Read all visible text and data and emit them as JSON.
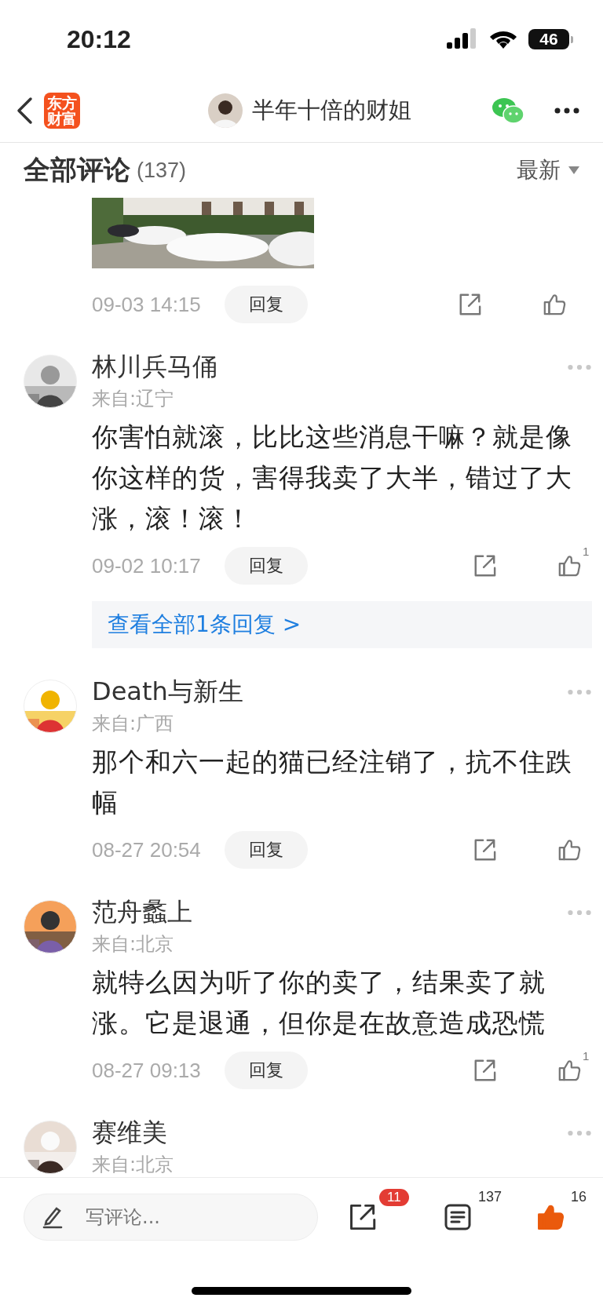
{
  "status_bar": {
    "time": "20:12",
    "battery": "46"
  },
  "nav": {
    "logo": "东方财富",
    "title": "半年十倍的财姐"
  },
  "comments_header": {
    "title": "全部评论",
    "count": "(137)",
    "sort": "最新"
  },
  "comments": [
    {
      "time": "09-03 14:15",
      "reply": "回复"
    },
    {
      "name": "林川兵马俑",
      "location": "来自:辽宁",
      "body": "你害怕就滚，比比这些消息干嘛？就是像你这样的货，害得我卖了大半，错过了大涨，滚！滚！",
      "time": "09-02 10:17",
      "reply": "回复",
      "likes": "1",
      "replies_link": "查看全部1条回复 >"
    },
    {
      "name": "Death与新生",
      "location": "来自:广西",
      "body": "那个和六一起的猫已经注销了，抗不住跌幅",
      "time": "08-27 20:54",
      "reply": "回复"
    },
    {
      "name": "范舟蠡上",
      "location": "来自:北京",
      "body": "就特么因为听了你的卖了，结果卖了就涨。它是退通，但你是在故意造成恐慌",
      "time": "08-27 09:13",
      "reply": "回复",
      "likes": "1"
    },
    {
      "name": "赛维美",
      "location": "来自:北京"
    }
  ],
  "bottom_bar": {
    "placeholder": "写评论...",
    "share_badge": "11",
    "comment_count": "137",
    "like_count": "16",
    "liked": true
  }
}
